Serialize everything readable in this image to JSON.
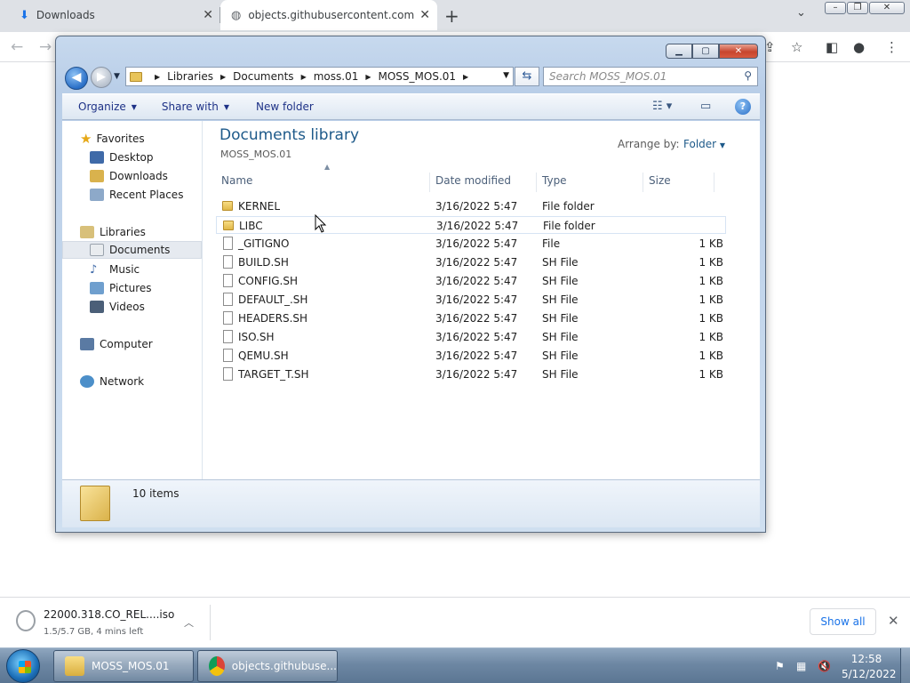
{
  "browser": {
    "tabs": [
      {
        "label": "Downloads",
        "icon": "download-icon"
      },
      {
        "label": "objects.githubusercontent.com",
        "icon": "globe-icon"
      }
    ],
    "close_glyph": "✕",
    "new_tab_glyph": "+"
  },
  "explorer": {
    "breadcrumb": [
      "Libraries",
      "Documents",
      "moss.01",
      "MOSS_MOS.01"
    ],
    "search_placeholder": "Search MOSS_MOS.01",
    "commands": {
      "organize": "Organize",
      "share": "Share with",
      "new_folder": "New folder"
    },
    "nav": {
      "favorites": "Favorites",
      "desktop": "Desktop",
      "downloads": "Downloads",
      "recent": "Recent Places",
      "libraries": "Libraries",
      "documents": "Documents",
      "music": "Music",
      "pictures": "Pictures",
      "videos": "Videos",
      "computer": "Computer",
      "network": "Network"
    },
    "library_title": "Documents library",
    "library_sub": "MOSS_MOS.01",
    "arrange_label": "Arrange by:",
    "arrange_value": "Folder",
    "columns": {
      "name": "Name",
      "date": "Date modified",
      "type": "Type",
      "size": "Size"
    },
    "files": [
      {
        "name": "KERNEL",
        "date": "3/16/2022 5:47",
        "type": "File folder",
        "size": ""
      },
      {
        "name": "LIBC",
        "date": "3/16/2022 5:47",
        "type": "File folder",
        "size": ""
      },
      {
        "name": "_GITIGNO",
        "date": "3/16/2022 5:47",
        "type": "File",
        "size": "1 KB"
      },
      {
        "name": "BUILD.SH",
        "date": "3/16/2022 5:47",
        "type": "SH File",
        "size": "1 KB"
      },
      {
        "name": "CONFIG.SH",
        "date": "3/16/2022 5:47",
        "type": "SH File",
        "size": "1 KB"
      },
      {
        "name": "DEFAULT_.SH",
        "date": "3/16/2022 5:47",
        "type": "SH File",
        "size": "1 KB"
      },
      {
        "name": "HEADERS.SH",
        "date": "3/16/2022 5:47",
        "type": "SH File",
        "size": "1 KB"
      },
      {
        "name": "ISO.SH",
        "date": "3/16/2022 5:47",
        "type": "SH File",
        "size": "1 KB"
      },
      {
        "name": "QEMU.SH",
        "date": "3/16/2022 5:47",
        "type": "SH File",
        "size": "1 KB"
      },
      {
        "name": "TARGET_T.SH",
        "date": "3/16/2022 5:47",
        "type": "SH File",
        "size": "1 KB"
      }
    ],
    "item_count": "10 items"
  },
  "download": {
    "name": "22000.318.CO_REL....iso",
    "status": "1.5/5.7 GB, 4 mins left",
    "show_all": "Show all"
  },
  "taskbar": {
    "explorer_btn": "MOSS_MOS.01",
    "chrome_btn": "objects.githubuse...",
    "time": "12:58",
    "date": "5/12/2022"
  },
  "colors": {
    "link_blue": "#1a73e8",
    "library_title": "#1e5a8a",
    "folder_yellow": "#e8c45a"
  }
}
